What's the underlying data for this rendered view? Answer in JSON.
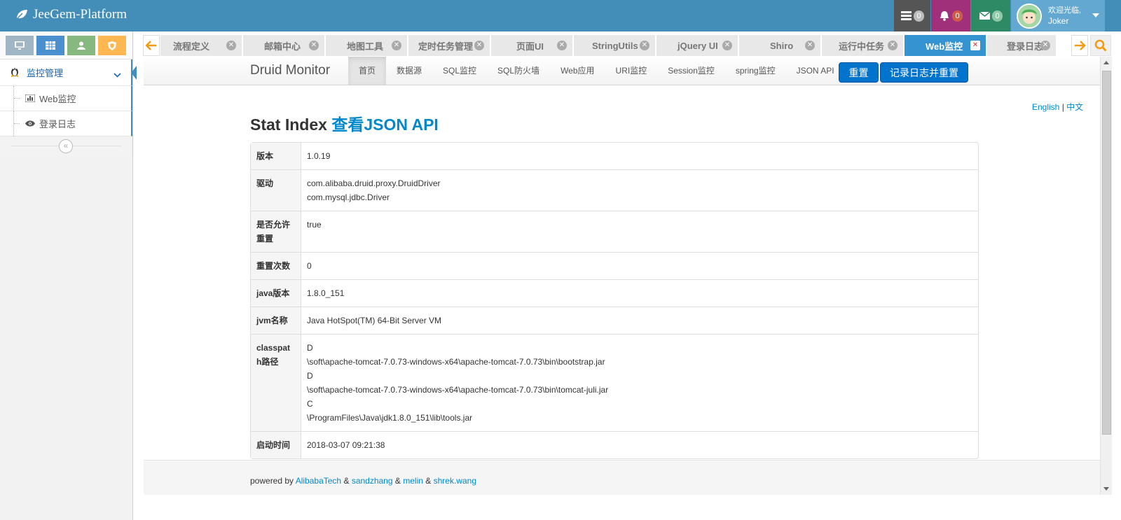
{
  "app": {
    "title": "JeeGem-Platform"
  },
  "toolbar": {
    "tasks_count": "0",
    "notifications_count": "0",
    "messages_count": "0",
    "user_greeting": "欢迎光临,",
    "user_name": "Joker"
  },
  "sidebar": {
    "menu_head": "监控管理",
    "items": [
      {
        "label": "Web监控",
        "icon": "chart-icon"
      },
      {
        "label": "登录日志",
        "icon": "eye-icon"
      }
    ],
    "collapse_glyph": "«"
  },
  "tabs": [
    {
      "label": "流程定义",
      "close": "✕"
    },
    {
      "label": "邮箱中心",
      "close": "✕"
    },
    {
      "label": "地图工具",
      "close": "✕"
    },
    {
      "label": "定时任务管理",
      "close": "✕"
    },
    {
      "label": "页面UI",
      "close": "✕"
    },
    {
      "label": "StringUtils",
      "close": "✕"
    },
    {
      "label": "jQuery UI",
      "close": "✕"
    },
    {
      "label": "Shiro",
      "close": "✕"
    },
    {
      "label": "运行中任务",
      "close": "✕"
    },
    {
      "label": "Web监控",
      "close": "✕",
      "active": true
    },
    {
      "label": "登录日志",
      "close": "✕"
    }
  ],
  "druid": {
    "brand": "Druid Monitor",
    "nav": [
      "首页",
      "数据源",
      "SQL监控",
      "SQL防火墙",
      "Web应用",
      "URI监控",
      "Session监控",
      "spring监控",
      "JSON API"
    ],
    "reset_button": "重置",
    "log_reset_button": "记录日志并重置",
    "lang_en": "English",
    "lang_sep": "|",
    "lang_zh": "中文",
    "title_prefix": "Stat Index",
    "title_link": "查看JSON API",
    "rows": [
      {
        "key": "版本",
        "lines": [
          "1.0.19"
        ]
      },
      {
        "key": "驱动",
        "lines": [
          "com.alibaba.druid.proxy.DruidDriver",
          "com.mysql.jdbc.Driver"
        ]
      },
      {
        "key": "是否允许重置",
        "lines": [
          "true"
        ]
      },
      {
        "key": "重置次数",
        "lines": [
          "0"
        ]
      },
      {
        "key": "java版本",
        "lines": [
          "1.8.0_151"
        ]
      },
      {
        "key": "jvm名称",
        "lines": [
          "Java HotSpot(TM) 64-Bit Server VM"
        ]
      },
      {
        "key": "classpath路径",
        "lines": [
          "D",
          "\\soft\\apache-tomcat-7.0.73-windows-x64\\apache-tomcat-7.0.73\\bin\\bootstrap.jar",
          "D",
          "\\soft\\apache-tomcat-7.0.73-windows-x64\\apache-tomcat-7.0.73\\bin\\tomcat-juli.jar",
          "C",
          "\\ProgramFiles\\Java\\jdk1.8.0_151\\lib\\tools.jar"
        ]
      },
      {
        "key": "启动时间",
        "lines": [
          "2018-03-07 09:21:38"
        ]
      }
    ],
    "footer": {
      "prefix": "powered by",
      "links": [
        "AlibabaTech",
        "sandzhang",
        "melin",
        "shrek.wang"
      ],
      "sep": "&"
    }
  },
  "colors": {
    "brand_bar": "#438eb9",
    "active_tab": "#3593d2",
    "primary_button": "#0074cc",
    "link": "#0088cc"
  }
}
